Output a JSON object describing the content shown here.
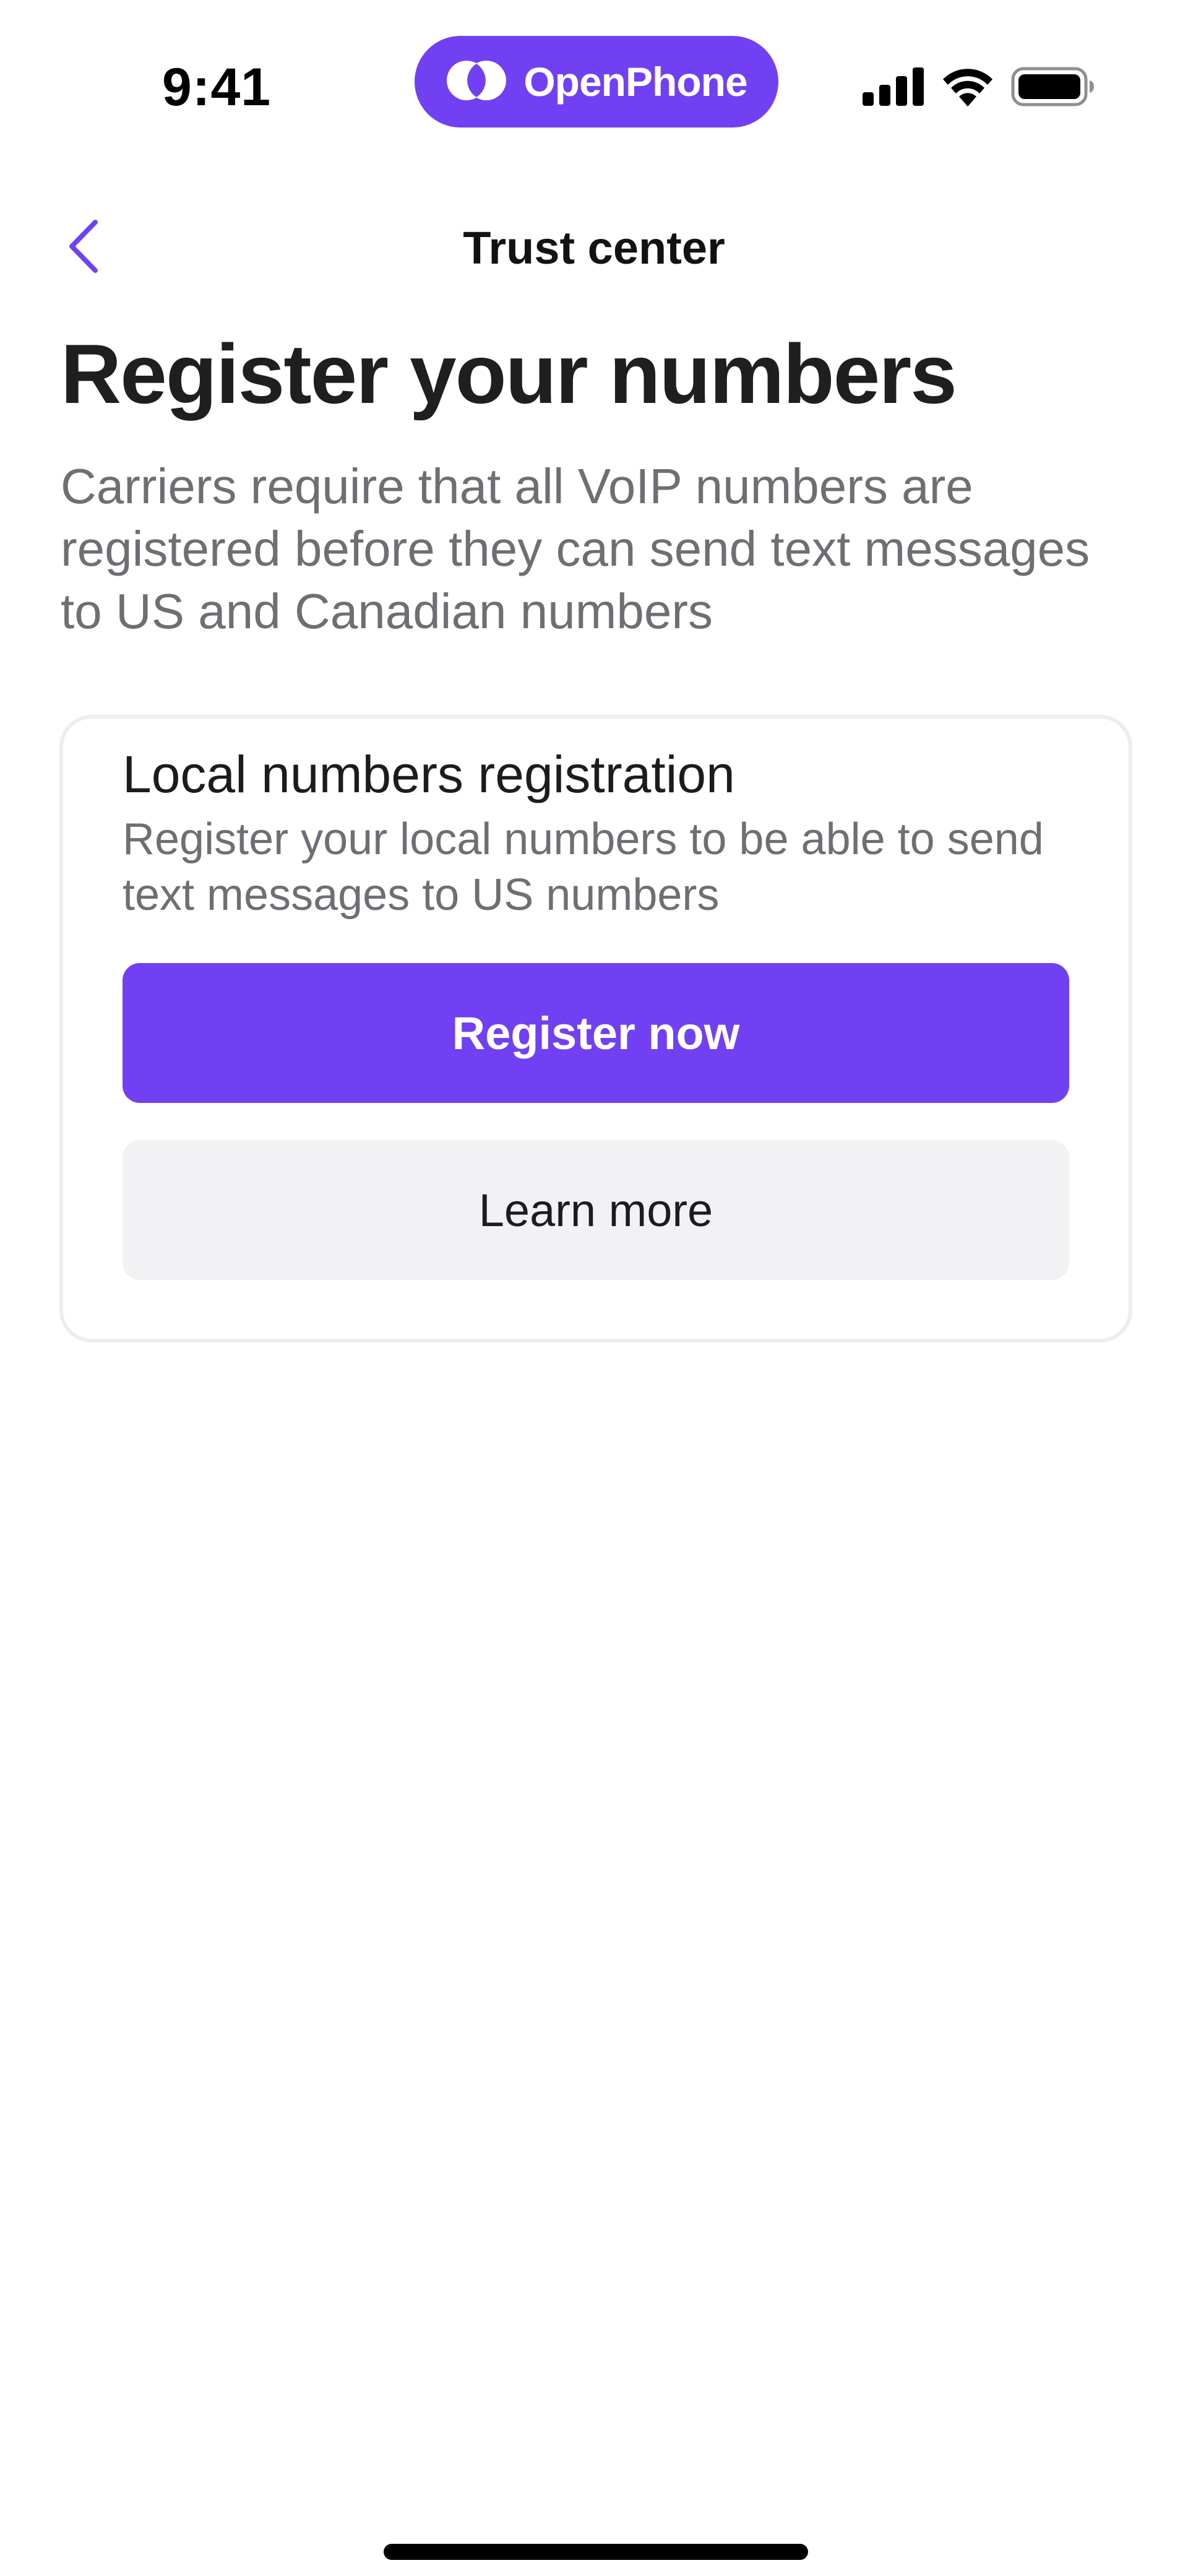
{
  "status_bar": {
    "time": "9:41",
    "brand": "OpenPhone",
    "icons": [
      "cellular-signal-icon",
      "wifi-icon",
      "battery-icon"
    ]
  },
  "nav": {
    "back_icon": "chevron-left-icon",
    "title": "Trust center"
  },
  "page": {
    "title": "Register your numbers",
    "subtitle": "Carriers require that all VoIP numbers are registered before they can send text messages to US and Canadian numbers"
  },
  "card": {
    "title": "Local numbers registration",
    "description": "Register your local numbers to be able to send text messages to US numbers",
    "primary_button": "Register now",
    "secondary_button": "Learn more"
  },
  "colors": {
    "accent": "#7140f3",
    "secondary_button_bg": "#f2f2f4",
    "muted_text": "#6e6e73",
    "card_border": "#ededf0"
  }
}
